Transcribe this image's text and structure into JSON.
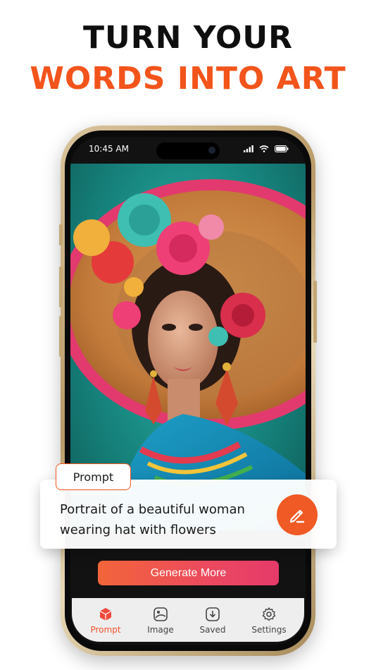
{
  "headline": {
    "line1": "TURN YOUR",
    "line2": "WORDS INTO ART"
  },
  "status_bar": {
    "time": "10:45 AM"
  },
  "prompt_card": {
    "tag": "Prompt",
    "text_line1": "Portrait of a beautiful woman",
    "text_line2": "wearing hat with flowers"
  },
  "actions": {
    "generate_label": "Generate More"
  },
  "tabs": [
    {
      "label": "Prompt",
      "icon": "cube-icon",
      "active": true
    },
    {
      "label": "Image",
      "icon": "image-icon",
      "active": false
    },
    {
      "label": "Saved",
      "icon": "download-icon",
      "active": false
    },
    {
      "label": "Settings",
      "icon": "gear-icon",
      "active": false
    }
  ],
  "colors": {
    "accent": "#f2541b",
    "headline_dark": "#0f0f0f",
    "phone_gold": "#c3a674"
  }
}
